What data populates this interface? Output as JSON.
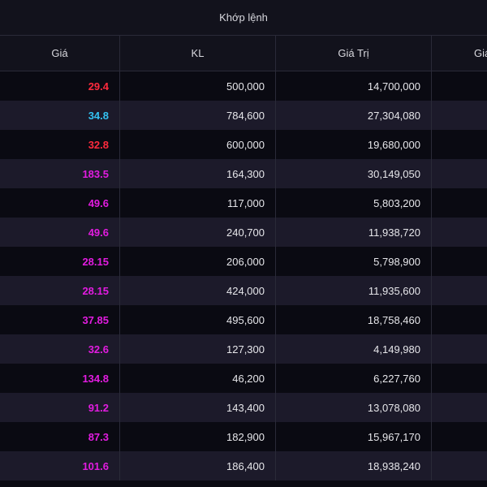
{
  "table": {
    "group_title": "Khớp lệnh",
    "columns": {
      "price": "Giá",
      "volume": "KL",
      "value": "Giá Trị",
      "extra": "Giá"
    },
    "rows": [
      {
        "price": "29.4",
        "price_color": "#ff2a3d",
        "volume": "500,000",
        "value": "14,700,000"
      },
      {
        "price": "34.8",
        "price_color": "#33c2f2",
        "volume": "784,600",
        "value": "27,304,080"
      },
      {
        "price": "32.8",
        "price_color": "#ff2a3d",
        "volume": "600,000",
        "value": "19,680,000"
      },
      {
        "price": "183.5",
        "price_color": "#e21ce0",
        "volume": "164,300",
        "value": "30,149,050"
      },
      {
        "price": "49.6",
        "price_color": "#e21ce0",
        "volume": "117,000",
        "value": "5,803,200"
      },
      {
        "price": "49.6",
        "price_color": "#e21ce0",
        "volume": "240,700",
        "value": "11,938,720"
      },
      {
        "price": "28.15",
        "price_color": "#e21ce0",
        "volume": "206,000",
        "value": "5,798,900"
      },
      {
        "price": "28.15",
        "price_color": "#e21ce0",
        "volume": "424,000",
        "value": "11,935,600"
      },
      {
        "price": "37.85",
        "price_color": "#e21ce0",
        "volume": "495,600",
        "value": "18,758,460"
      },
      {
        "price": "32.6",
        "price_color": "#e21ce0",
        "volume": "127,300",
        "value": "4,149,980"
      },
      {
        "price": "134.8",
        "price_color": "#e21ce0",
        "volume": "46,200",
        "value": "6,227,760"
      },
      {
        "price": "91.2",
        "price_color": "#e21ce0",
        "volume": "143,400",
        "value": "13,078,080"
      },
      {
        "price": "87.3",
        "price_color": "#e21ce0",
        "volume": "182,900",
        "value": "15,967,170"
      },
      {
        "price": "101.6",
        "price_color": "#e21ce0",
        "volume": "186,400",
        "value": "18,938,240"
      }
    ]
  }
}
